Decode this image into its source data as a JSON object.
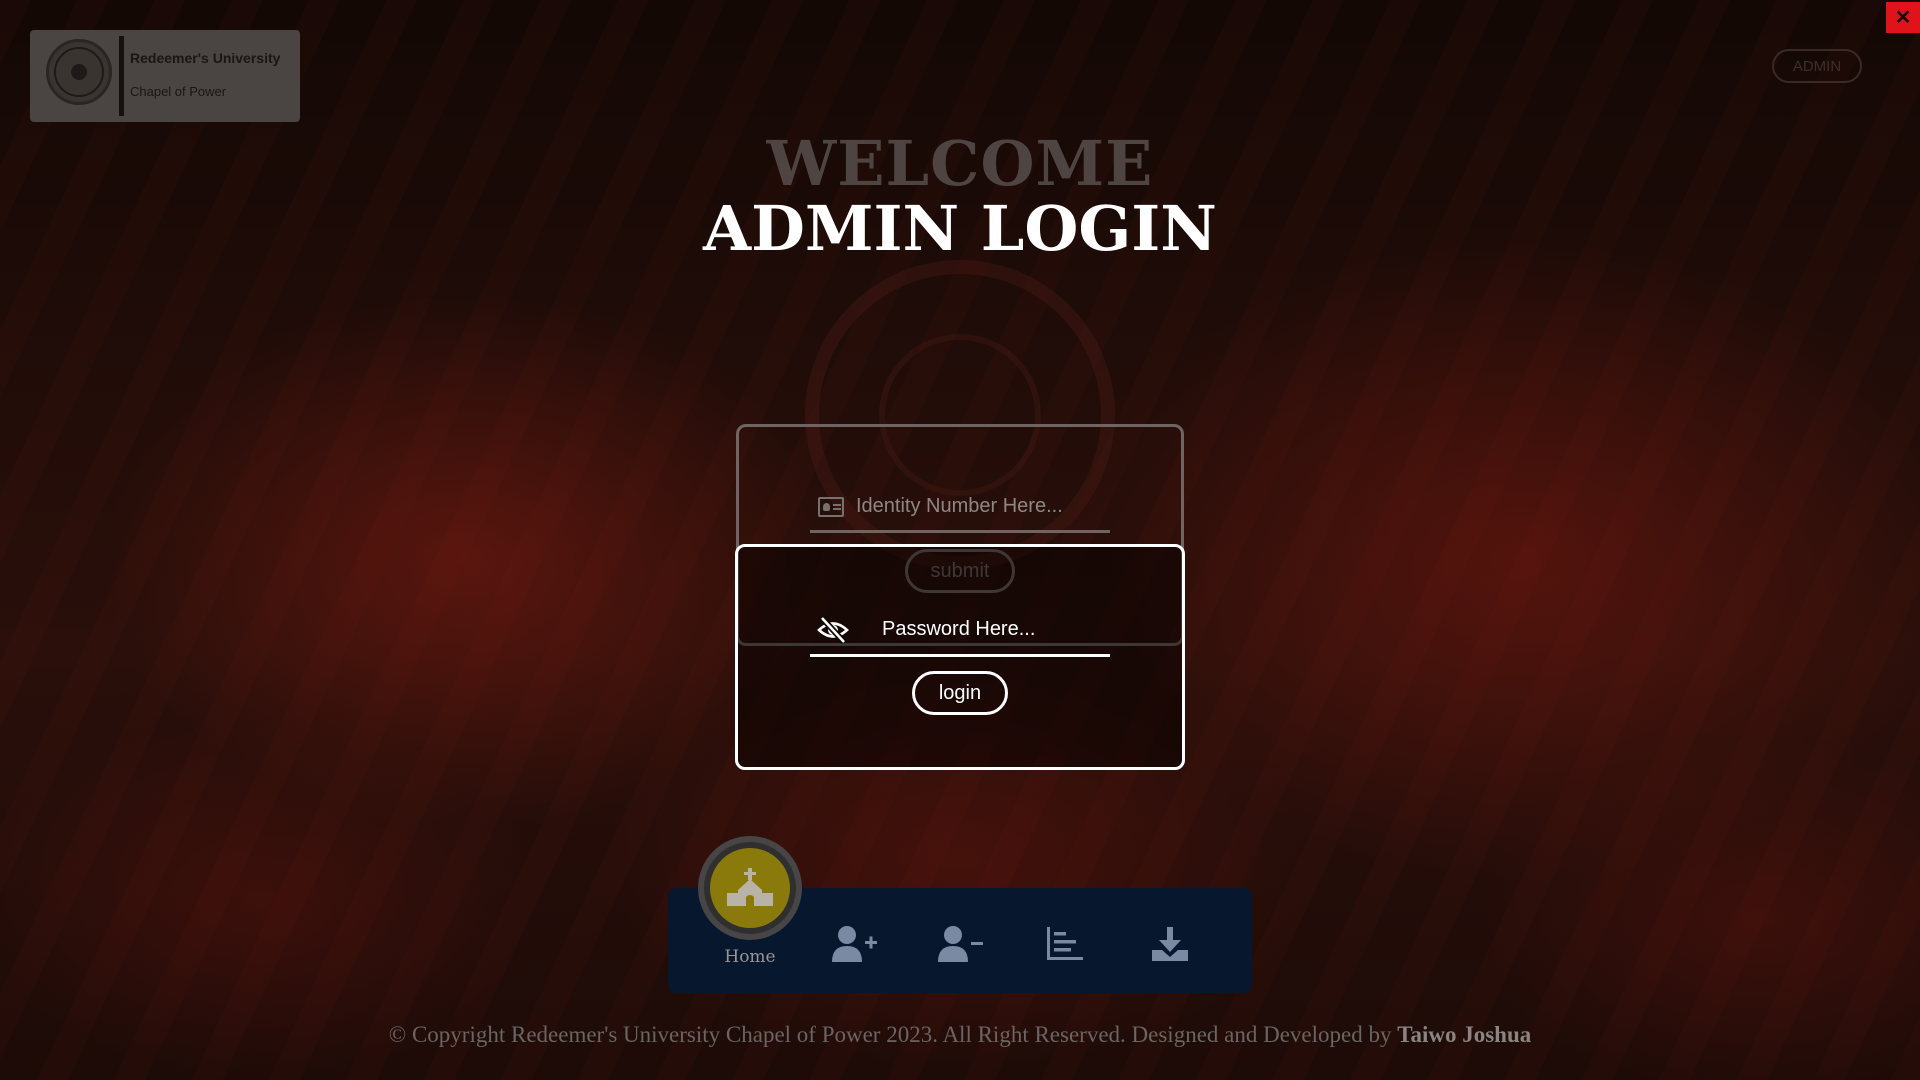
{
  "brand": {
    "title": "Redeemer's University",
    "subtitle": "Chapel of Power"
  },
  "header": {
    "admin_label": "ADMIN",
    "close_label": "✕"
  },
  "hero": {
    "welcome": "WELCOME",
    "title": "ADMIN LOGIN"
  },
  "identity_form": {
    "placeholder": "Identity Number Here...",
    "value": "",
    "submit_label": "submit"
  },
  "password_form": {
    "placeholder": "Password Here...",
    "value": "",
    "login_label": "login"
  },
  "nav": {
    "home_label": "Home",
    "items": [
      {
        "icon": "add-user-icon"
      },
      {
        "icon": "remove-user-icon"
      },
      {
        "icon": "chart-icon"
      },
      {
        "icon": "download-icon"
      }
    ]
  },
  "footer": {
    "text": "© Copyright Redeemer's University Chapel of Power 2023. All Right Reserved. Designed and Developed by ",
    "author": "Taiwo Joshua"
  },
  "colors": {
    "close_button": "#e0131b",
    "nav_bar": "#06172e",
    "home_accent": "#8a7a0b"
  }
}
